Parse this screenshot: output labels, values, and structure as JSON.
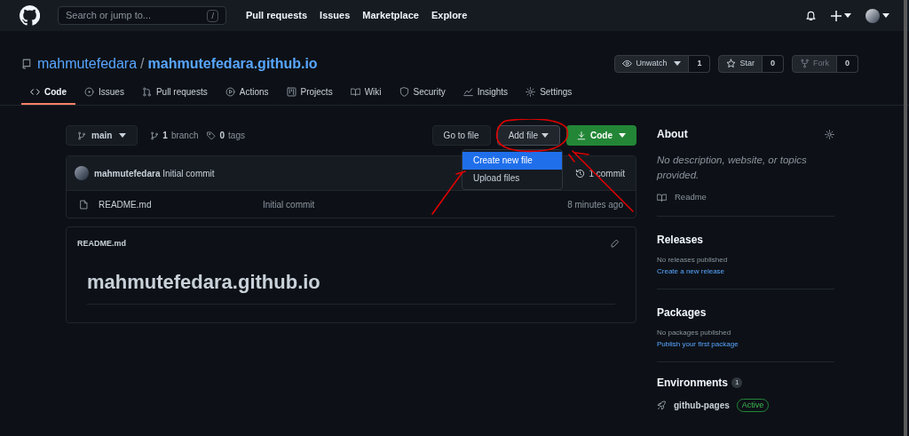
{
  "header": {
    "search": {
      "placeholder": "Search or jump to...",
      "shortcut": "/"
    },
    "nav": [
      "Pull requests",
      "Issues",
      "Marketplace",
      "Explore"
    ]
  },
  "repo": {
    "owner": "mahmutefedara",
    "separator": "/",
    "name": "mahmutefedara.github.io",
    "actions": [
      {
        "label": "Unwatch",
        "count": "1",
        "disabled": false,
        "caret": true
      },
      {
        "label": "Star",
        "count": "0",
        "disabled": false,
        "caret": false
      },
      {
        "label": "Fork",
        "count": "0",
        "disabled": true,
        "caret": false
      }
    ]
  },
  "tabs": [
    {
      "label": "Code",
      "selected": true
    },
    {
      "label": "Issues",
      "selected": false
    },
    {
      "label": "Pull requests",
      "selected": false
    },
    {
      "label": "Actions",
      "selected": false
    },
    {
      "label": "Projects",
      "selected": false
    },
    {
      "label": "Wiki",
      "selected": false
    },
    {
      "label": "Security",
      "selected": false
    },
    {
      "label": "Insights",
      "selected": false
    },
    {
      "label": "Settings",
      "selected": false
    }
  ],
  "toolbar": {
    "branch": "main",
    "branches": {
      "count": "1",
      "label": "branch"
    },
    "tags": {
      "count": "0",
      "label": "tags"
    },
    "go_to_file": "Go to file",
    "add_file": "Add file",
    "code": "Code"
  },
  "add_file_menu": [
    {
      "label": "Create new file",
      "selected": true
    },
    {
      "label": "Upload files",
      "selected": false
    }
  ],
  "commit": {
    "author": "mahmutefedara",
    "message": "Initial commit",
    "commits": "1 commit"
  },
  "files": [
    {
      "name": "README.md",
      "message": "Initial commit",
      "time": "8 minutes ago"
    }
  ],
  "readme": {
    "file": "README.md",
    "heading": "mahmutefedara.github.io"
  },
  "about": {
    "title": "About",
    "description": "No description, website, or topics provided.",
    "readme": "Readme"
  },
  "releases": {
    "title": "Releases",
    "note": "No releases published",
    "link": "Create a new release"
  },
  "packages": {
    "title": "Packages",
    "note": "No packages published",
    "link": "Publish your first package"
  },
  "environments": {
    "title": "Environments",
    "count": "1",
    "items": [
      {
        "name": "github-pages",
        "status": "Active"
      }
    ]
  }
}
